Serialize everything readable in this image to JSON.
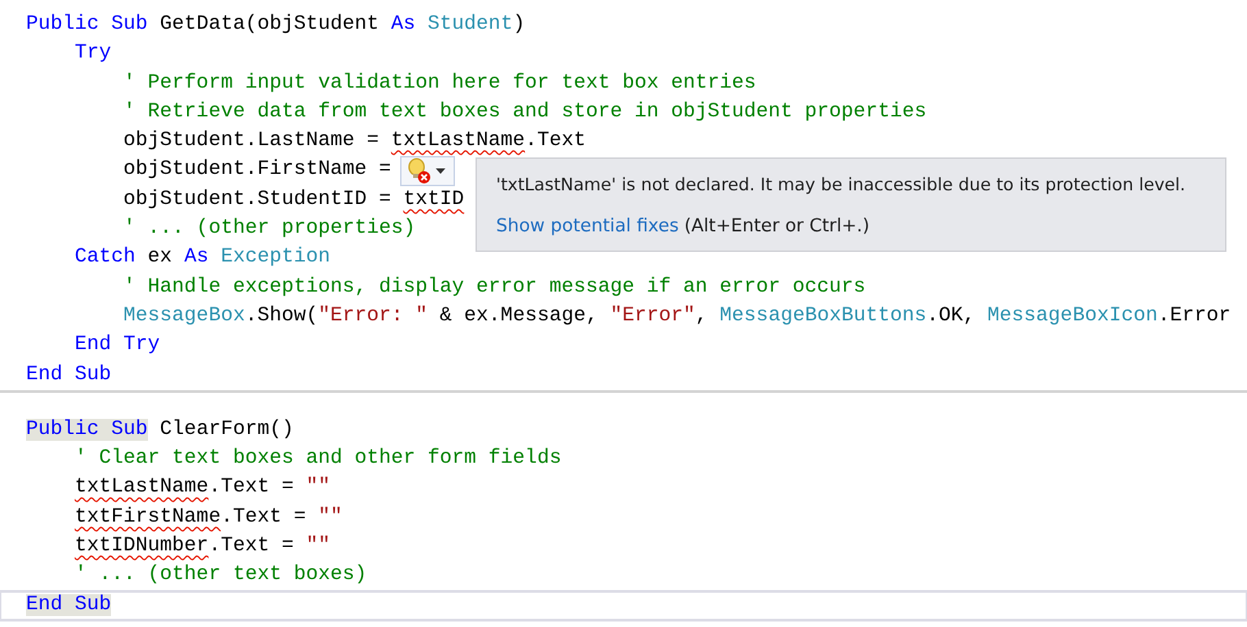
{
  "code_blocks": [
    {
      "lines": [
        {
          "current": false,
          "tokens": [
            {
              "text": "Public Sub",
              "kind": "keyword",
              "highlighted": false
            },
            {
              "text": " GetData(objStudent ",
              "kind": "plain"
            },
            {
              "text": "As",
              "kind": "keyword"
            },
            {
              "text": " Student",
              "kind": "type"
            },
            {
              "text": ")",
              "kind": "plain"
            }
          ],
          "children": [
            {
              "current": false,
              "tokens": [
                {
                  "text": "Try",
                  "kind": "keyword"
                }
              ],
              "children": [
                {
                  "current": false,
                  "tokens": [
                    {
                      "text": "' Perform input validation here for text box entries",
                      "kind": "comment"
                    }
                  ]
                },
                {
                  "current": false,
                  "tokens": [
                    {
                      "text": "' Retrieve data from text boxes and store in objStudent properties",
                      "kind": "comment"
                    }
                  ]
                },
                {
                  "current": false,
                  "tokens": [
                    {
                      "text": "objStudent.LastName = ",
                      "kind": "plain"
                    },
                    {
                      "text": "txtLastName",
                      "kind": "plain",
                      "error": true
                    },
                    {
                      "text": ".Text",
                      "kind": "plain"
                    }
                  ]
                },
                {
                  "current": false,
                  "tokens": [
                    {
                      "text": "objStudent.FirstName =",
                      "kind": "plain"
                    }
                  ]
                },
                {
                  "current": false,
                  "tokens": [
                    {
                      "text": "objStudent.StudentID = ",
                      "kind": "plain"
                    },
                    {
                      "text": "txtID",
                      "kind": "plain",
                      "error": true
                    }
                  ]
                },
                {
                  "current": false,
                  "tokens": [
                    {
                      "text": "' ... (other properties)",
                      "kind": "comment"
                    }
                  ]
                }
              ]
            },
            {
              "current": false,
              "tokens": [
                {
                  "text": "Catch",
                  "kind": "keyword"
                },
                {
                  "text": " ex ",
                  "kind": "plain"
                },
                {
                  "text": "As",
                  "kind": "keyword"
                },
                {
                  "text": " Exception",
                  "kind": "type"
                }
              ],
              "children": [
                {
                  "current": false,
                  "tokens": [
                    {
                      "text": "' Handle exceptions, display error message if an error occurs",
                      "kind": "comment"
                    }
                  ]
                },
                {
                  "current": false,
                  "tokens": [
                    {
                      "text": "MessageBox",
                      "kind": "type"
                    },
                    {
                      "text": ".Show(",
                      "kind": "plain"
                    },
                    {
                      "text": "\"Error: \"",
                      "kind": "string"
                    },
                    {
                      "text": " & ex.Message, ",
                      "kind": "plain"
                    },
                    {
                      "text": "\"Error\"",
                      "kind": "string"
                    },
                    {
                      "text": ", ",
                      "kind": "plain"
                    },
                    {
                      "text": "MessageBoxButtons",
                      "kind": "type"
                    },
                    {
                      "text": ".OK, ",
                      "kind": "plain"
                    },
                    {
                      "text": "MessageBoxIcon",
                      "kind": "type"
                    },
                    {
                      "text": ".Error",
                      "kind": "plain"
                    }
                  ]
                }
              ]
            },
            {
              "current": false,
              "tokens": [
                {
                  "text": "End Try",
                  "kind": "keyword"
                }
              ]
            }
          ]
        },
        {
          "current": false,
          "tokens": [
            {
              "text": "End Sub",
              "kind": "keyword",
              "highlighted": false
            }
          ]
        }
      ]
    },
    {
      "lines": [
        {
          "current": false,
          "tokens": [
            {
              "text": "Public Sub",
              "kind": "keyword",
              "highlighted": true
            },
            {
              "text": " ClearForm()",
              "kind": "plain"
            }
          ],
          "children": [
            {
              "current": false,
              "tokens": [
                {
                  "text": "' Clear text boxes and other form fields",
                  "kind": "comment"
                }
              ]
            },
            {
              "current": false,
              "tokens": [
                {
                  "text": "txtLastName",
                  "kind": "plain",
                  "error": true
                },
                {
                  "text": ".Text = ",
                  "kind": "plain"
                },
                {
                  "text": "\"\"",
                  "kind": "string"
                }
              ]
            },
            {
              "current": false,
              "tokens": [
                {
                  "text": "txtFirstName",
                  "kind": "plain",
                  "error": true
                },
                {
                  "text": ".Text = ",
                  "kind": "plain"
                },
                {
                  "text": "\"\"",
                  "kind": "string"
                }
              ]
            },
            {
              "current": false,
              "tokens": [
                {
                  "text": "txtIDNumber",
                  "kind": "plain",
                  "error": true
                },
                {
                  "text": ".Text = ",
                  "kind": "plain"
                },
                {
                  "text": "\"\"",
                  "kind": "string"
                }
              ]
            },
            {
              "current": false,
              "tokens": [
                {
                  "text": "' ... (other text boxes)",
                  "kind": "comment"
                }
              ]
            }
          ]
        },
        {
          "current": true,
          "tokens": [
            {
              "text": "End Sub",
              "kind": "keyword",
              "highlighted": true
            }
          ]
        }
      ]
    }
  ],
  "tooltip": {
    "message": "'txtLastName' is not declared. It may be inaccessible due to its protection level.",
    "link": "Show potential fixes",
    "shortcut": "(Alt+Enter or Ctrl+.)"
  }
}
